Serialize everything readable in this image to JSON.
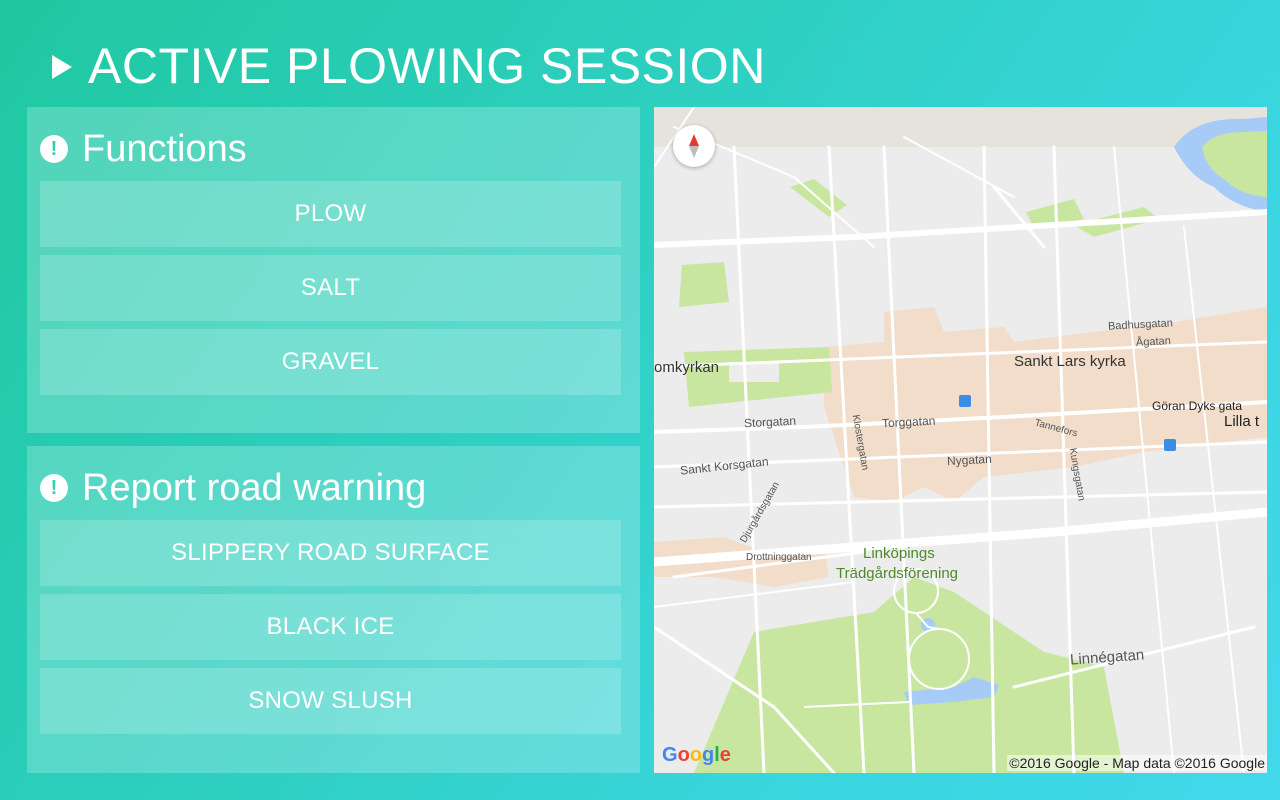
{
  "header": {
    "title": "ACTIVE PLOWING SESSION",
    "icon": "play-triangle-icon"
  },
  "functions_panel": {
    "title": "Functions",
    "icon": "alert-circle-icon",
    "buttons": [
      {
        "label": "PLOW"
      },
      {
        "label": "SALT"
      },
      {
        "label": "GRAVEL"
      }
    ]
  },
  "warnings_panel": {
    "title": "Report road warning",
    "icon": "alert-circle-icon",
    "buttons": [
      {
        "label": "SLIPPERY ROAD SURFACE"
      },
      {
        "label": "BLACK ICE"
      },
      {
        "label": "SNOW SLUSH"
      }
    ]
  },
  "map": {
    "attribution": "©2016 Google - Map data ©2016 Google",
    "logo": {
      "letters": [
        {
          "ch": "G",
          "color": "#4285f4"
        },
        {
          "ch": "o",
          "color": "#ea4335"
        },
        {
          "ch": "o",
          "color": "#fbbc05"
        },
        {
          "ch": "g",
          "color": "#4285f4"
        },
        {
          "ch": "l",
          "color": "#34a853"
        },
        {
          "ch": "e",
          "color": "#ea4335"
        }
      ]
    },
    "labels": {
      "domkyrkan": "omkyrkan",
      "sankt_lars": "Sankt Lars kyrka",
      "badhusgatan": "Badhusgatan",
      "agatan": "Ågatan",
      "goran_dyks": "Göran Dyks gata",
      "lilla": "Lilla t",
      "storgatan": "Storgatan",
      "torggatan": "Torggatan",
      "nygatan": "Nygatan",
      "sankt_korsgatan": "Sankt Korsgatan",
      "drottninggatan": "Drottninggatan",
      "tradgard1": "Linköpings",
      "tradgard2": "Trädgårdsförening",
      "linnegatan": "Linnégatan",
      "tannefors": "Tannefors",
      "djurgardsgatan": "Djurgårdsgatan",
      "klostergatan": "Klostergatan",
      "kungsgatan": "Kungsgatan"
    },
    "colors": {
      "land": "#ececec",
      "park": "#c9e6a1",
      "urban": "#f1ddc9",
      "water": "#a6cbf7",
      "road": "#ffffff",
      "park_text": "#4e8a2b"
    }
  }
}
